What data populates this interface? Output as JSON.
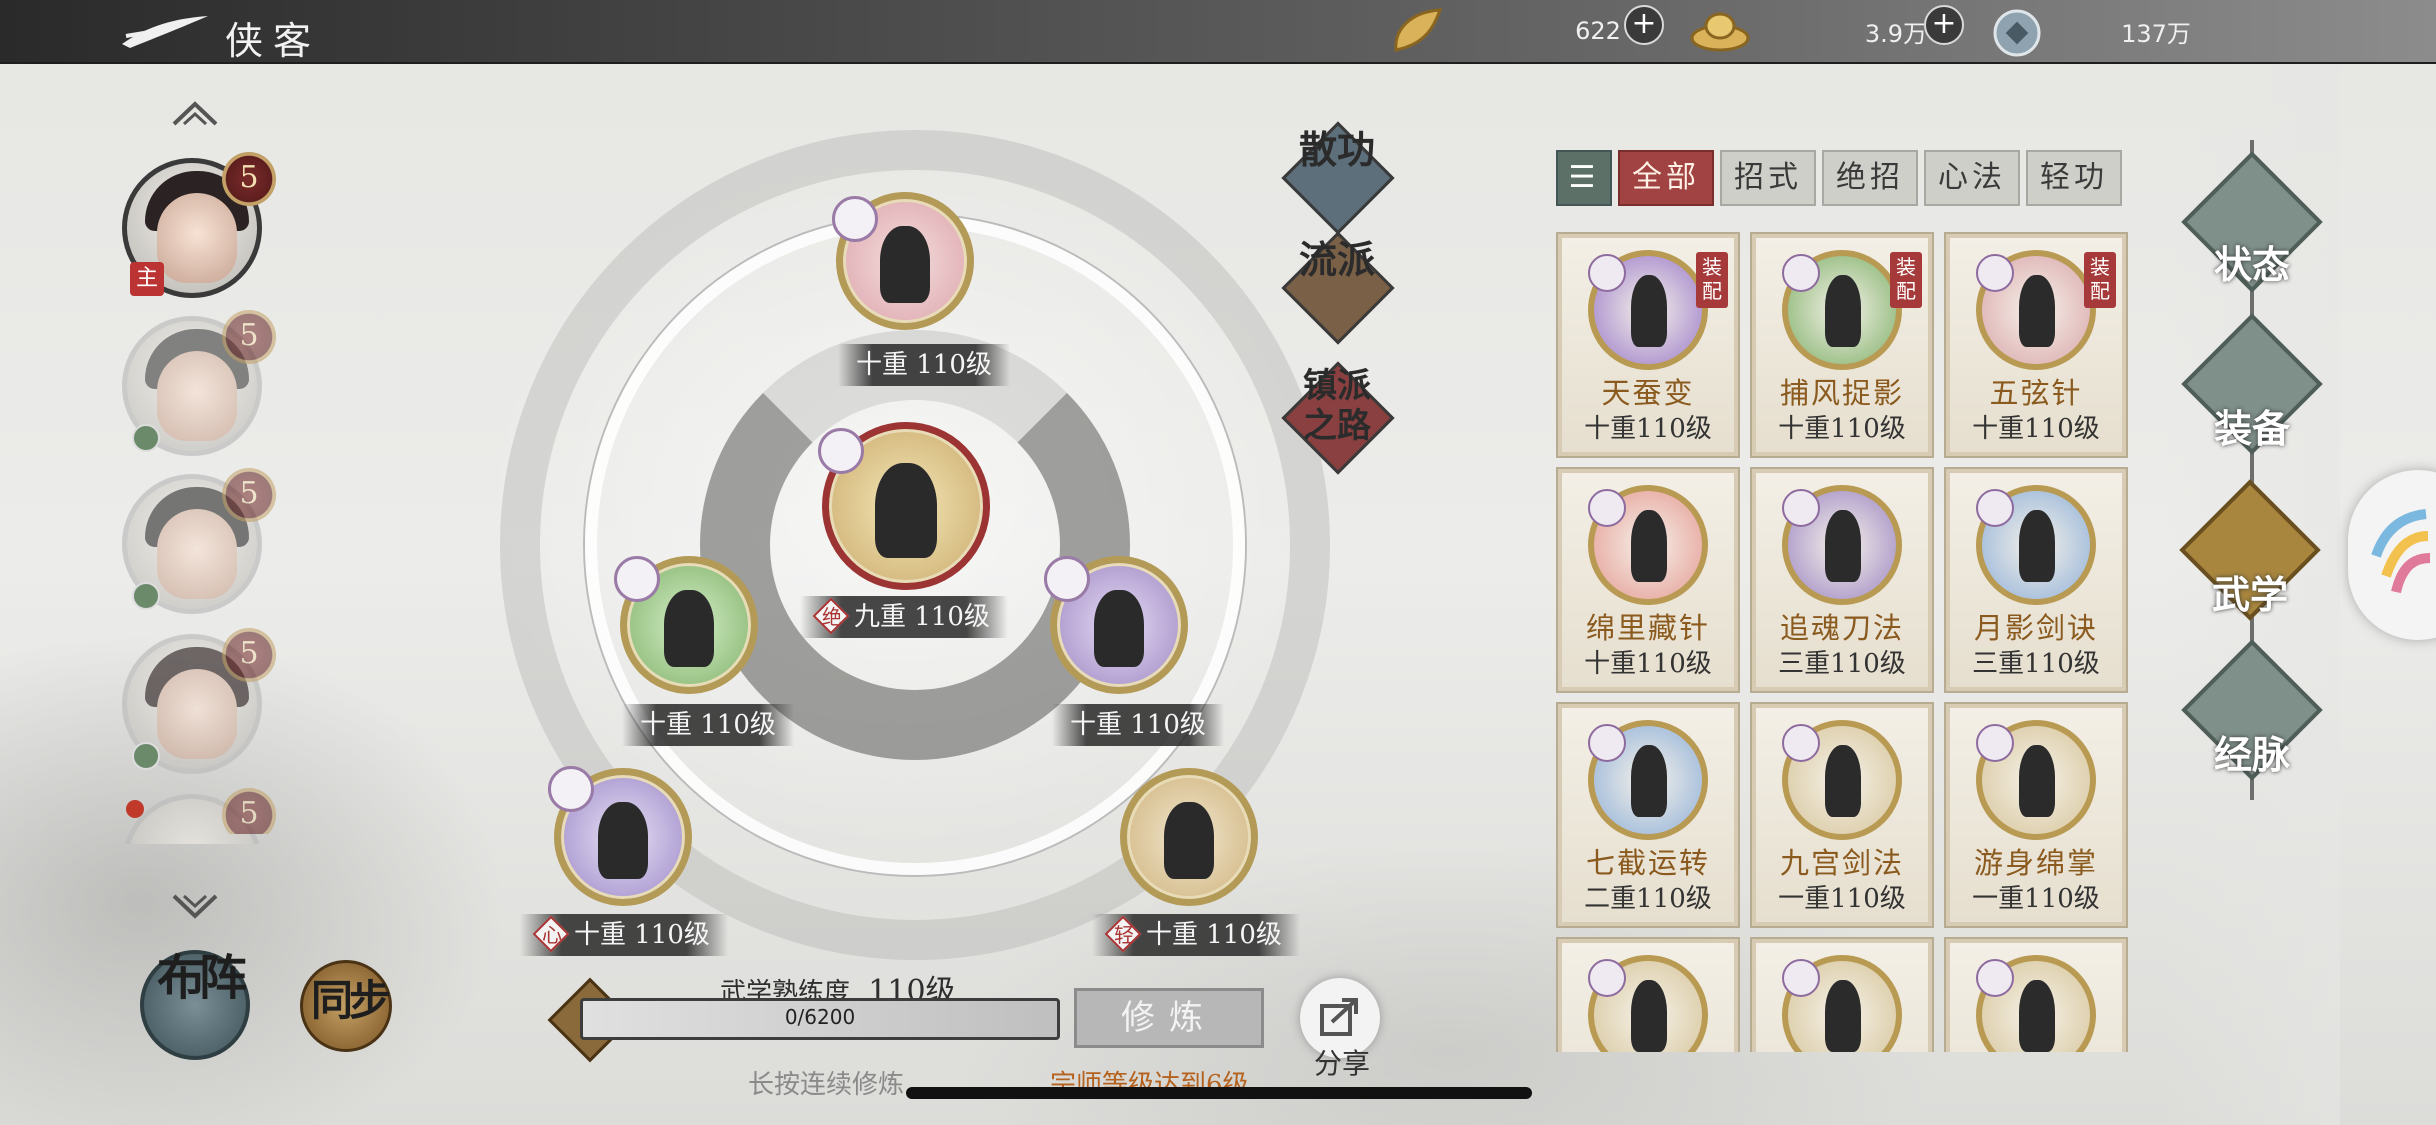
{
  "header": {
    "title": "侠客",
    "resources": [
      {
        "icon": "gold-ingot-icon",
        "value": "622"
      },
      {
        "icon": "gold-boat-ingot-icon",
        "value": "3.9万"
      },
      {
        "icon": "copper-coin-icon",
        "value": "137万"
      }
    ]
  },
  "heroes": [
    {
      "level": "5",
      "badge": "主"
    },
    {
      "level": "5",
      "badge": ""
    },
    {
      "level": "5",
      "badge": ""
    },
    {
      "level": "5",
      "badge": ""
    },
    {
      "level": "5",
      "badge": ""
    }
  ],
  "left_buttons": {
    "formation": "布阵",
    "sync": "同步"
  },
  "center": {
    "slots": [
      {
        "label": "十重 110级"
      },
      {
        "label": "九重 110级",
        "prefix": "绝"
      },
      {
        "label": "十重 110级"
      },
      {
        "label": "十重 110级"
      },
      {
        "label": "十重 110级",
        "prefix": "心"
      },
      {
        "label": "十重 110级",
        "prefix": "轻"
      }
    ],
    "side_buttons": [
      "散功",
      "流派",
      "镇派之路"
    ],
    "proficiency_label": "武学熟练度",
    "proficiency_level": "110级",
    "progress_text": "0/6200",
    "progress_fraction": 0,
    "train_button": "修炼",
    "share_button": "分享",
    "hint_left": "长按连续修炼",
    "hint_right": "宗师等级达到6级"
  },
  "filter_tabs": [
    "全部",
    "招式",
    "绝招",
    "心法",
    "轻功"
  ],
  "filter_active": "全部",
  "skills": [
    {
      "name": "天蚕变",
      "level": "十重110级",
      "equipped": "装配",
      "color": "#9a7ac8"
    },
    {
      "name": "捕风捉影",
      "level": "十重110级",
      "equipped": "装配",
      "color": "#7fb068"
    },
    {
      "name": "五弦针",
      "level": "十重110级",
      "equipped": "装配",
      "color": "#d9a6aa"
    },
    {
      "name": "绵里藏针",
      "level": "十重110级",
      "equipped": "",
      "color": "#e49a92"
    },
    {
      "name": "追魂刀法",
      "level": "三重110级",
      "equipped": "",
      "color": "#9c86c2"
    },
    {
      "name": "月影剑诀",
      "level": "三重110级",
      "equipped": "",
      "color": "#8fb0d8"
    },
    {
      "name": "七截运转",
      "level": "二重110级",
      "equipped": "",
      "color": "#8fb0d8"
    },
    {
      "name": "九宫剑法",
      "level": "一重110级",
      "equipped": "",
      "color": "#d6c59a"
    },
    {
      "name": "游身绵掌",
      "level": "一重110级",
      "equipped": "",
      "color": "#d6c59a"
    },
    {
      "name": "",
      "level": "",
      "equipped": "",
      "color": "#d6c59a"
    },
    {
      "name": "",
      "level": "",
      "equipped": "",
      "color": "#d6c59a"
    },
    {
      "name": "",
      "level": "",
      "equipped": "",
      "color": "#d6c59a"
    }
  ],
  "right_nav": {
    "items": [
      "状态",
      "装备",
      "武学",
      "经脉"
    ],
    "active": "武学"
  },
  "colors": {
    "accent_red": "#a24343",
    "gold": "#b99a52",
    "topbar": "#2a2a2a"
  }
}
